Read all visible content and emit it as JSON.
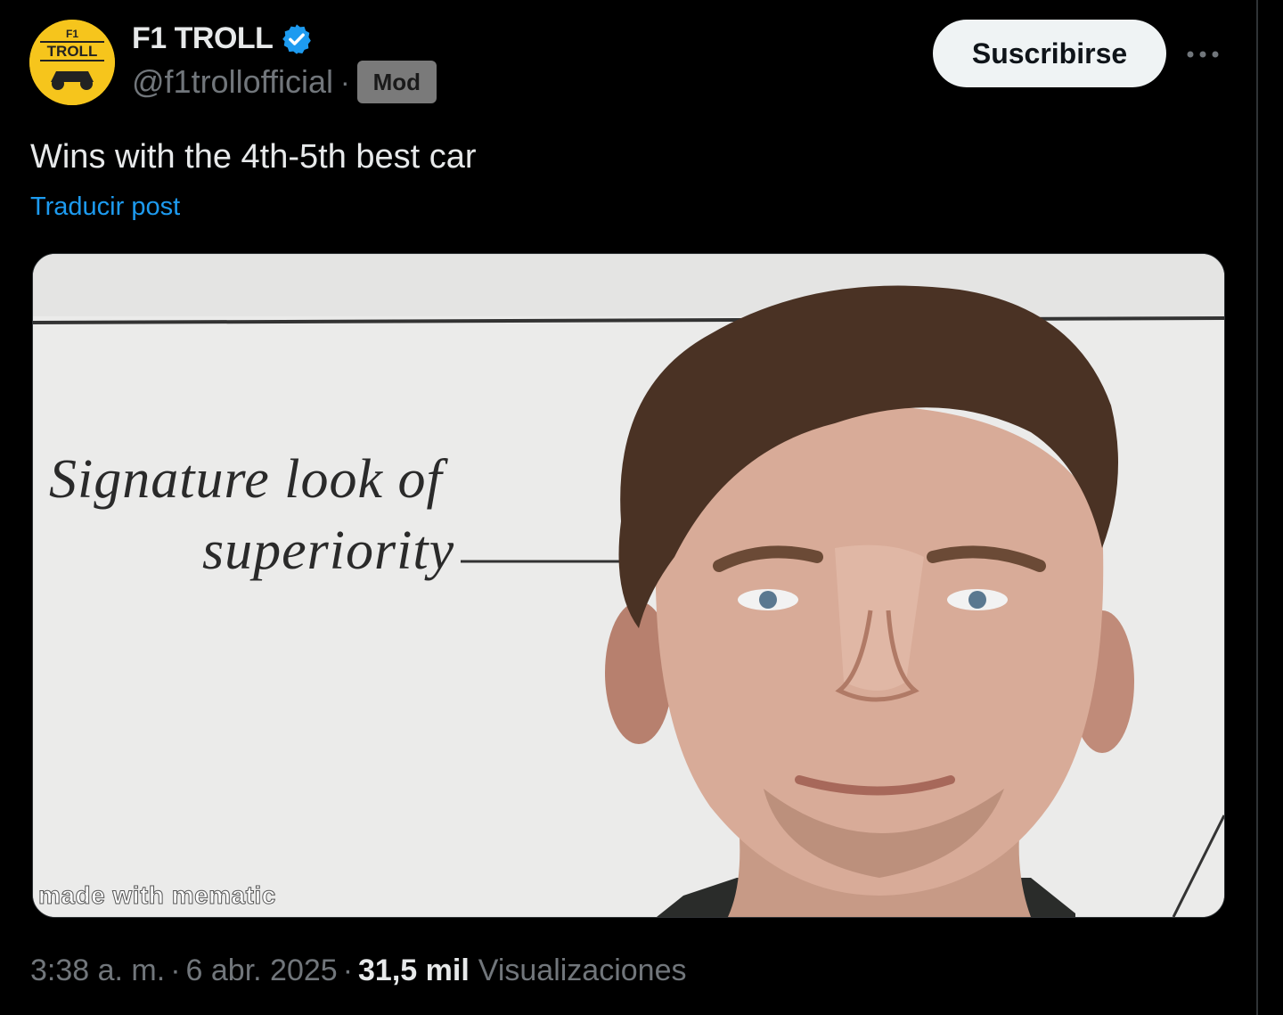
{
  "author": {
    "display_name": "F1 TROLL",
    "handle": "@f1trollofficial",
    "separator": "·",
    "badge": "Mod",
    "avatar_text": "F1 TROLL"
  },
  "actions": {
    "subscribe_label": "Suscribirse",
    "more_label": "···"
  },
  "post": {
    "text": "Wins with the 4th-5th best car",
    "translate_label": "Traducir post"
  },
  "media": {
    "caption_line1": "Signature look of",
    "caption_line2": "superiority",
    "watermark": "made with mematic"
  },
  "footer": {
    "time": "3:38 a. m.",
    "date": "6 abr. 2025",
    "views_count": "31,5 mil",
    "views_label": "Visualizaciones",
    "separator": "·"
  },
  "colors": {
    "background": "#000000",
    "link": "#1d9bf0",
    "verified": "#1d9bf0",
    "avatar": "#f6c51c"
  },
  "icons": [
    "verified-badge-icon",
    "more-icon"
  ]
}
